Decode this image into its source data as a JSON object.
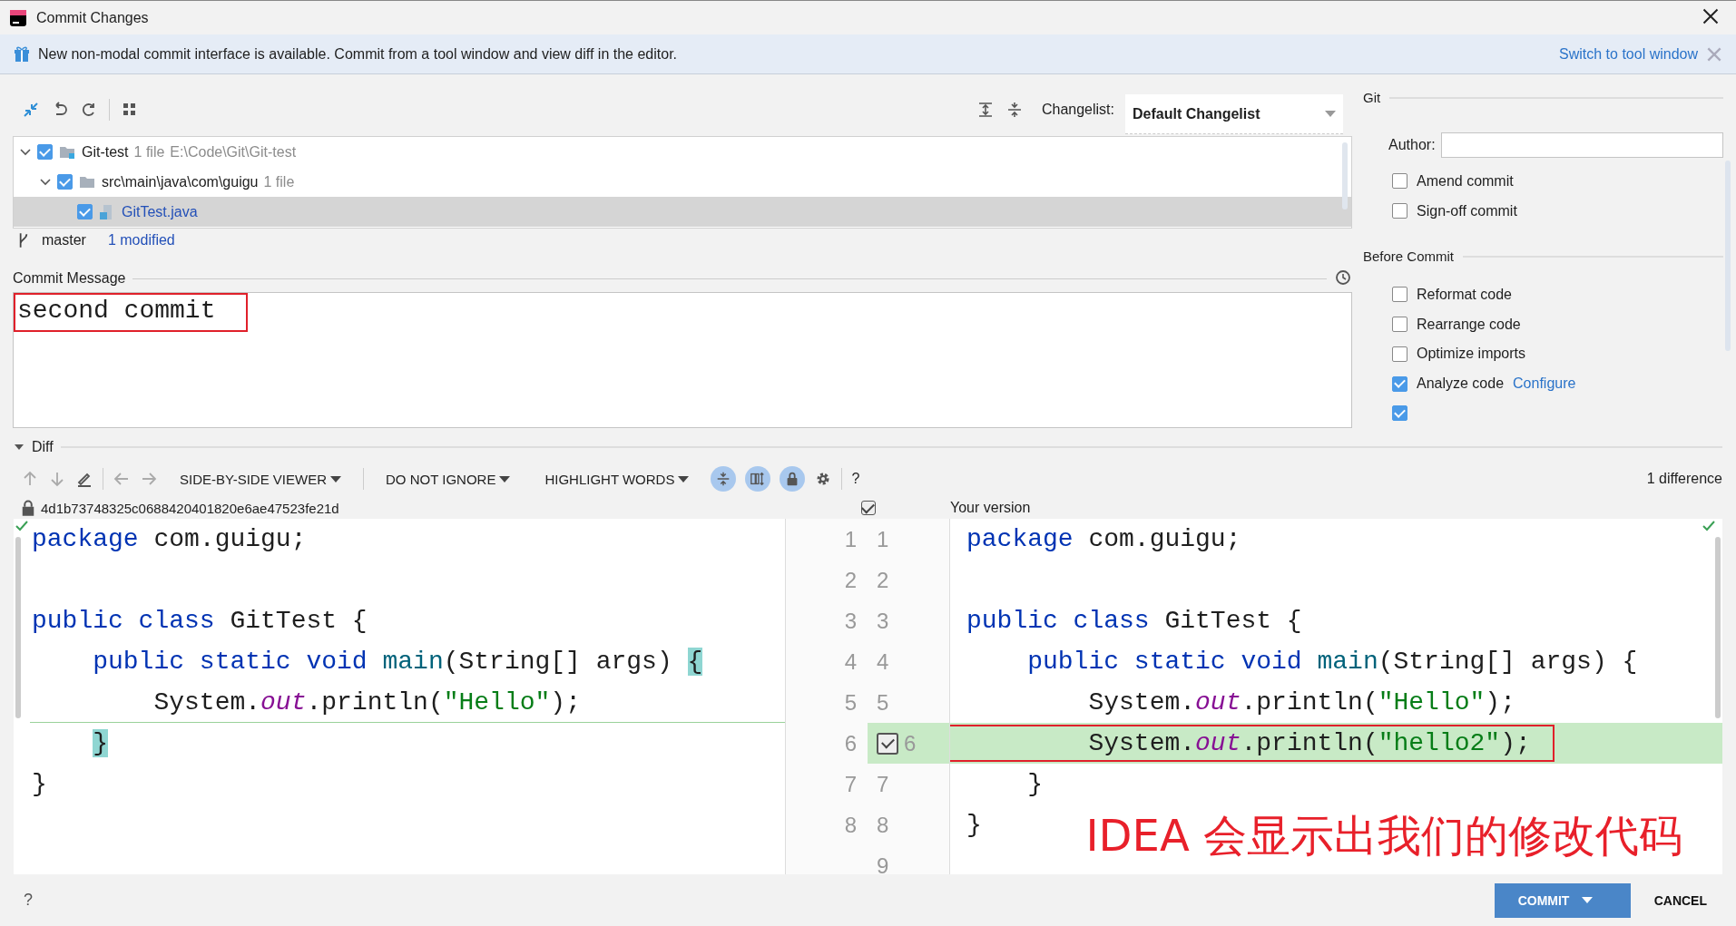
{
  "window": {
    "title": "Commit Changes"
  },
  "banner": {
    "message": "New non-modal commit interface is available. Commit from a tool window and view diff in the editor.",
    "link": "Switch to tool window"
  },
  "changelist": {
    "label": "Changelist:",
    "value": "Default Changelist"
  },
  "tree": [
    {
      "name": "Git-test",
      "kind": "module",
      "expanded": true,
      "checked": true,
      "selected": false,
      "count": "1 file",
      "path": "E:\\Code\\Git\\Git-test",
      "children": [
        {
          "name": "src\\main\\java\\com\\guigu",
          "kind": "folder",
          "expanded": true,
          "checked": true,
          "selected": false,
          "count": "1 file",
          "children": [
            {
              "name": "GitTest.java",
              "kind": "file",
              "checked": true,
              "selected": true
            }
          ]
        }
      ]
    }
  ],
  "branch": {
    "name": "master",
    "changes": "1 modified"
  },
  "commit_message": {
    "label": "Commit Message",
    "value": "second commit",
    "marked": true
  },
  "git": {
    "title": "Git",
    "author_label": "Author:",
    "options": [
      {
        "label": "Amend commit",
        "checked": false
      },
      {
        "label": "Sign-off commit",
        "checked": false
      }
    ]
  },
  "before_commit": {
    "title": "Before Commit",
    "options": [
      {
        "label": "Reformat code",
        "checked": false
      },
      {
        "label": "Rearrange code",
        "checked": false
      },
      {
        "label": "Optimize imports",
        "checked": false
      },
      {
        "label": "Analyze code",
        "link": "Configure",
        "checked": true
      },
      {
        "checked": true
      }
    ]
  },
  "diff": {
    "title": "Diff",
    "expanded": true,
    "viewer": "SIDE-BY-SIDE VIEWER",
    "ignore": "DO NOT IGNORE",
    "highlight": "HIGHLIGHT WORDS",
    "toggles": [
      {
        "kind": "collapse",
        "selected": true
      },
      {
        "kind": "sync",
        "selected": true
      },
      {
        "kind": "lock",
        "selected": true
      }
    ],
    "help": "?",
    "summary": "1 difference",
    "left_title": "4d1b73748325c0688420401820e6ae47523fe21d",
    "right_title": "Your version",
    "right_checked": true,
    "left_lines": [
      {
        "number": "1",
        "tokens": [
          {
            "t": "package",
            "kind": "kw"
          },
          {
            "t": " com.guigu;",
            "kind": "plain"
          }
        ]
      },
      {
        "number": "2"
      },
      {
        "number": "3",
        "tokens": [
          {
            "t": "public class",
            "kind": "kw"
          },
          {
            "t": " GitTest {",
            "kind": "plain"
          }
        ]
      },
      {
        "number": "4",
        "tokens": [
          {
            "t": "    public static void",
            "kind": "kw"
          },
          {
            "t": " main",
            "kind": "method"
          },
          {
            "t": "(String[] args) ",
            "kind": "plain"
          },
          {
            "t": "{",
            "kind": "hl"
          }
        ]
      },
      {
        "number": "5",
        "kind": "insertion-point",
        "tokens": [
          {
            "t": "        System.",
            "kind": "plain"
          },
          {
            "t": "out",
            "kind": "field"
          },
          {
            "t": ".println(",
            "kind": "plain"
          },
          {
            "t": "\"Hello\"",
            "kind": "str"
          },
          {
            "t": ");",
            "kind": "plain"
          }
        ]
      },
      {
        "number": "6",
        "tokens": [
          {
            "t": "    }",
            "kind": "hl"
          }
        ]
      },
      {
        "number": "7",
        "tokens": [
          {
            "t": "}",
            "kind": "plain"
          }
        ]
      },
      {
        "number": "8"
      }
    ],
    "right_lines": [
      {
        "number": "1",
        "tokens": [
          {
            "t": "package",
            "kind": "kw"
          },
          {
            "t": " com.guigu;",
            "kind": "plain"
          }
        ]
      },
      {
        "number": "2"
      },
      {
        "number": "3",
        "tokens": [
          {
            "t": "public class",
            "kind": "kw"
          },
          {
            "t": " GitTest {",
            "kind": "plain"
          }
        ]
      },
      {
        "number": "4",
        "tokens": [
          {
            "t": "    public static void",
            "kind": "kw"
          },
          {
            "t": " main",
            "kind": "method"
          },
          {
            "t": "(String[] args) {",
            "kind": "plain"
          }
        ]
      },
      {
        "number": "5",
        "tokens": [
          {
            "t": "        System.",
            "kind": "plain"
          },
          {
            "t": "out",
            "kind": "field"
          },
          {
            "t": ".println(",
            "kind": "plain"
          },
          {
            "t": "\"Hello\"",
            "kind": "str"
          },
          {
            "t": ");",
            "kind": "plain"
          }
        ]
      },
      {
        "number": "6",
        "kind": "inserted",
        "checked": true,
        "marked": true,
        "tokens": [
          {
            "t": "        System.",
            "kind": "plain"
          },
          {
            "t": "out",
            "kind": "field"
          },
          {
            "t": ".println(",
            "kind": "plain"
          },
          {
            "t": "\"hello2\"",
            "kind": "str"
          },
          {
            "t": ");",
            "kind": "plain"
          }
        ]
      },
      {
        "number": "7",
        "tokens": [
          {
            "t": "    }",
            "kind": "plain"
          }
        ]
      },
      {
        "number": "8",
        "tokens": [
          {
            "t": "}",
            "kind": "plain"
          }
        ]
      },
      {
        "number": "9"
      }
    ]
  },
  "annotation": "IDEA 会显示出我们的修改代码",
  "footer": {
    "help": "?",
    "buttons": [
      {
        "label": "COMMIT",
        "kind": "primary"
      },
      {
        "label": "CANCEL",
        "kind": "plain"
      }
    ]
  }
}
